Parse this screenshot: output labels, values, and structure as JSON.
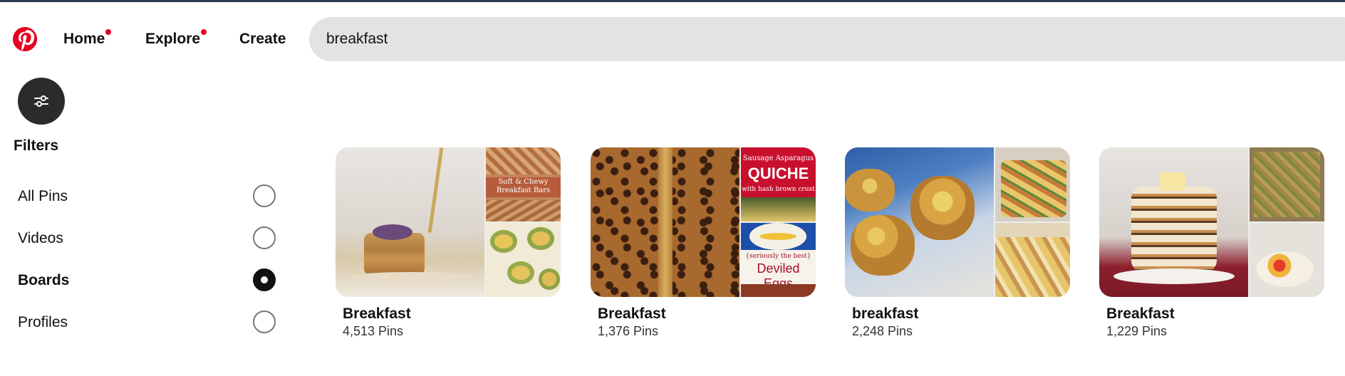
{
  "header": {
    "logo_icon": "pinterest-logo",
    "nav": [
      {
        "label": "Home",
        "has_dot": true
      },
      {
        "label": "Explore",
        "has_dot": true
      },
      {
        "label": "Create",
        "has_dot": false
      }
    ],
    "search_value": "breakfast"
  },
  "sidebar": {
    "filter_button_icon": "sliders-icon",
    "title": "Filters",
    "options": [
      {
        "label": "All Pins",
        "checked": false
      },
      {
        "label": "Videos",
        "checked": false
      },
      {
        "label": "Boards",
        "checked": true
      },
      {
        "label": "Profiles",
        "checked": false
      }
    ]
  },
  "boards": [
    {
      "title": "Breakfast",
      "count": "4,513 Pins",
      "tile_text": {
        "top": "Soft & Chewy Breakfast Bars"
      }
    },
    {
      "title": "Breakfast",
      "count": "1,376 Pins",
      "tile_text": {
        "top_small": "Sausage Asparagus",
        "top_big": "QUICHE",
        "top_sub": "with hash brown crust",
        "bottom_small": "{seriously the best}",
        "bottom_big": "Deviled Eggs"
      }
    },
    {
      "title": "breakfast",
      "count": "2,248 Pins"
    },
    {
      "title": "Breakfast",
      "count": "1,229 Pins"
    }
  ],
  "colors": {
    "accent": "#e60023",
    "search_bg": "#e3e3e3",
    "filter_button_bg": "#2b2b2b"
  }
}
